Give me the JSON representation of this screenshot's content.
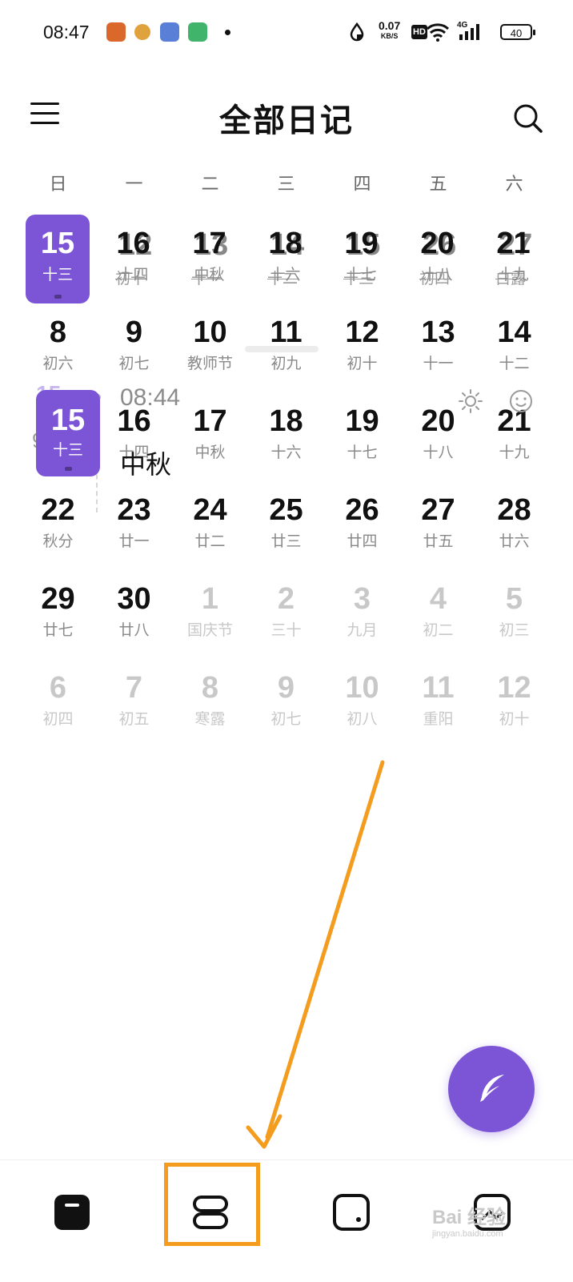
{
  "status_bar": {
    "time": "08:47",
    "net_speed": "0.07",
    "net_unit": "KB/S",
    "hd": "HD",
    "signal": "4G",
    "battery": "40"
  },
  "header": {
    "title": "全部日记",
    "menu_icon": "menu-icon",
    "search_icon": "search-icon"
  },
  "weekdays": [
    "日",
    "一",
    "二",
    "三",
    "四",
    "五",
    "六"
  ],
  "calendar": {
    "rows": [
      [
        {
          "d": "15",
          "l": "十三",
          "state": "selected"
        },
        {
          "d": "16",
          "l": "十四",
          "state": "normal"
        },
        {
          "d": "17",
          "l": "中秋",
          "state": "normal"
        },
        {
          "d": "18",
          "l": "十六",
          "state": "normal"
        },
        {
          "d": "19",
          "l": "十七",
          "state": "normal"
        },
        {
          "d": "20",
          "l": "十八",
          "state": "normal"
        },
        {
          "d": "21",
          "l": "十九",
          "state": "normal"
        }
      ],
      [
        {
          "d": "8",
          "l": "初六",
          "state": "normal"
        },
        {
          "d": "9",
          "l": "初七",
          "state": "normal"
        },
        {
          "d": "10",
          "l": "教师节",
          "state": "normal"
        },
        {
          "d": "11",
          "l": "初九",
          "state": "normal"
        },
        {
          "d": "12",
          "l": "初十",
          "state": "normal"
        },
        {
          "d": "13",
          "l": "十一",
          "state": "normal"
        },
        {
          "d": "14",
          "l": "十二",
          "state": "normal"
        }
      ],
      [
        {
          "d": "15",
          "l": "十三",
          "state": "hidden"
        },
        {
          "d": "16",
          "l": "十四",
          "state": "normal"
        },
        {
          "d": "17",
          "l": "中秋",
          "state": "normal"
        },
        {
          "d": "18",
          "l": "十六",
          "state": "normal"
        },
        {
          "d": "19",
          "l": "十七",
          "state": "normal"
        },
        {
          "d": "20",
          "l": "十八",
          "state": "normal"
        },
        {
          "d": "21",
          "l": "十九",
          "state": "normal"
        }
      ],
      [
        {
          "d": "22",
          "l": "秋分",
          "state": "normal"
        },
        {
          "d": "23",
          "l": "廿一",
          "state": "normal"
        },
        {
          "d": "24",
          "l": "廿二",
          "state": "normal"
        },
        {
          "d": "25",
          "l": "廿三",
          "state": "normal"
        },
        {
          "d": "26",
          "l": "廿四",
          "state": "normal"
        },
        {
          "d": "27",
          "l": "廿五",
          "state": "normal"
        },
        {
          "d": "28",
          "l": "廿六",
          "state": "normal"
        }
      ],
      [
        {
          "d": "29",
          "l": "廿七",
          "state": "normal"
        },
        {
          "d": "30",
          "l": "廿八",
          "state": "normal"
        },
        {
          "d": "1",
          "l": "国庆节",
          "state": "muted"
        },
        {
          "d": "2",
          "l": "三十",
          "state": "muted"
        },
        {
          "d": "3",
          "l": "九月",
          "state": "muted"
        },
        {
          "d": "4",
          "l": "初二",
          "state": "muted"
        },
        {
          "d": "5",
          "l": "初三",
          "state": "muted"
        }
      ],
      [
        {
          "d": "6",
          "l": "初四",
          "state": "muted"
        },
        {
          "d": "7",
          "l": "初五",
          "state": "muted"
        },
        {
          "d": "8",
          "l": "寒露",
          "state": "muted"
        },
        {
          "d": "9",
          "l": "初七",
          "state": "muted"
        },
        {
          "d": "10",
          "l": "初八",
          "state": "muted"
        },
        {
          "d": "11",
          "l": "重阳",
          "state": "muted"
        },
        {
          "d": "12",
          "l": "初十",
          "state": "muted"
        }
      ]
    ],
    "ghost_row": [
      {
        "d": "12",
        "l": "初十"
      },
      {
        "d": "13",
        "l": "十一"
      },
      {
        "d": "14",
        "l": "十二"
      },
      {
        "d": "15",
        "l": "十三"
      },
      {
        "d": "26",
        "l": "初四"
      },
      {
        "d": "27",
        "l": "白露"
      }
    ]
  },
  "entry_preview": {
    "day": "15",
    "month": "9月",
    "time": "08:44",
    "title": "中秋",
    "weather_icon": "sun-icon",
    "mood_icon": "smiley-icon"
  },
  "fab": {
    "icon": "feather-icon"
  },
  "bottom_nav": [
    {
      "name": "nav-notes",
      "icon": "note-icon"
    },
    {
      "name": "nav-timeline",
      "icon": "timeline-icon"
    },
    {
      "name": "nav-cards",
      "icon": "card-icon"
    },
    {
      "name": "nav-gallery",
      "icon": "gallery-icon"
    }
  ],
  "watermark": {
    "text": "Bai 经验",
    "sub": "jingyan.baidu.com"
  },
  "colors": {
    "accent": "#7b55d6",
    "annotation": "#f39c1e"
  }
}
